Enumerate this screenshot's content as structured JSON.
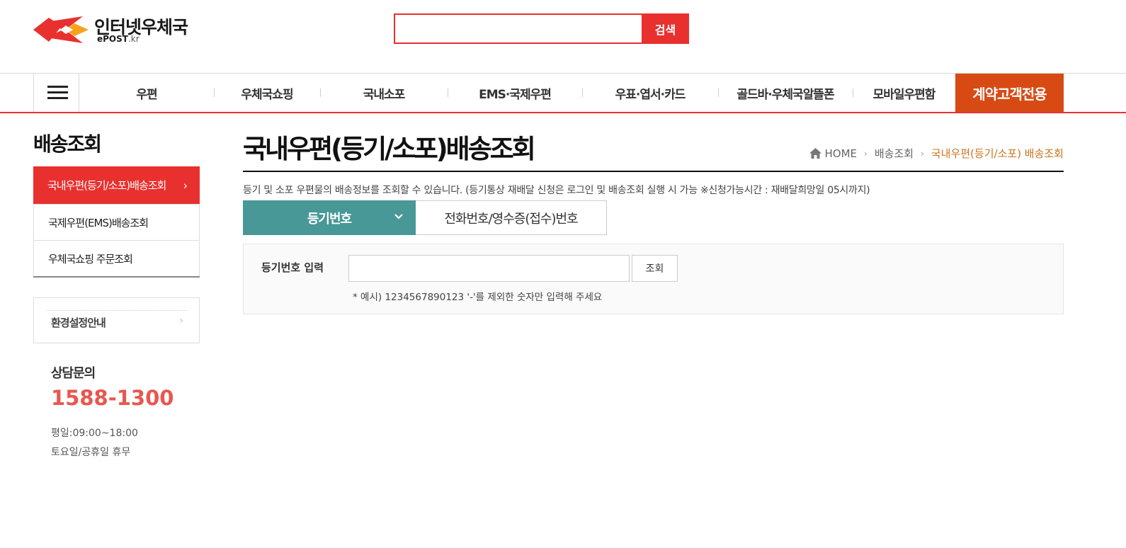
{
  "header": {
    "logo_title": "인터넷우체국",
    "logo_sub_main": "ePOST",
    "logo_sub_domain": ".kr",
    "search": {
      "value": "",
      "placeholder": "",
      "button_label": "검색"
    }
  },
  "gnb": {
    "items": [
      "우편",
      "우체국쇼핑",
      "국내소포",
      "EMS·국제우편",
      "우표·엽서·카드",
      "골드바·우체국알뜰폰",
      "모바일우편함"
    ],
    "special_label": "계약고객전용"
  },
  "lnb": {
    "title": "배송조회",
    "items": [
      "국내우편(등기/소포)배송조회",
      "국제우편(EMS)배송조회",
      "우체국쇼핑 주문조회"
    ],
    "env_label": "환경설정안내"
  },
  "contact": {
    "title": "상담문의",
    "phone": "1588-1300",
    "hours_weekday": "평일:09:00~18:00",
    "hours_weekend": "토요일/공휴일 휴무"
  },
  "content": {
    "title": "국내우편(등기/소포)배송조회",
    "breadcrumb": [
      "HOME",
      "배송조회",
      "국내우편(등기/소포) 배송조회"
    ],
    "description": "등기 및 소포 우편물의 배송정보를 조회할 수 있습니다. (등기통상 재배달 신청은 로그인 및 배송조회 실행 시 가능 ※신청가능시간 : 재배달희망일 05시까지)",
    "tabs": [
      "등기번호",
      "전화번호/영수증(접수)번호"
    ],
    "form": {
      "label": "등기번호 입력",
      "value": "",
      "button_label": "조회",
      "hint": "* 예시) 1234567890123 '-'를 제외한 숫자만 입력해 주세요"
    }
  },
  "colors": {
    "brand_red": "#e8312f",
    "special_orange": "#d84a14",
    "tab_teal": "#479896",
    "phone_red": "#e8574f",
    "breadcrumb_current": "#c8761f"
  },
  "icons": [
    "epost-logo",
    "hamburger-icon",
    "chevron-right-icon",
    "home-icon",
    "chevron-down-icon"
  ]
}
